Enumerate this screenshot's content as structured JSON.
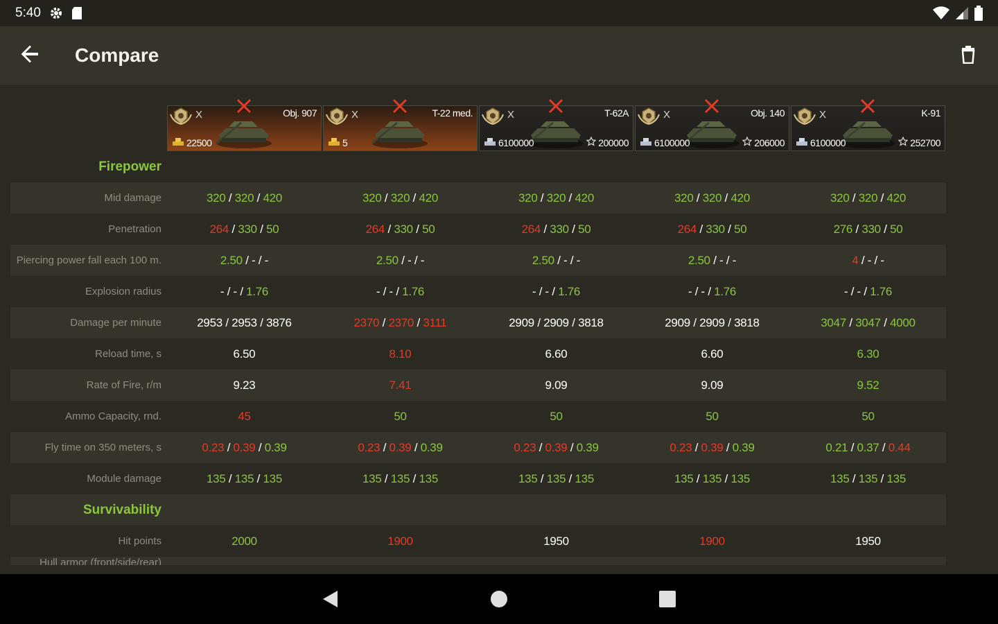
{
  "status": {
    "time": "5:40"
  },
  "app": {
    "title": "Compare"
  },
  "tanks": [
    {
      "tier": "X",
      "name": "Obj. 907",
      "price_left": "22500",
      "price_right": "",
      "premium": true
    },
    {
      "tier": "X",
      "name": "T-22 med.",
      "price_left": "5",
      "price_right": "",
      "premium": true
    },
    {
      "tier": "X",
      "name": "T-62A",
      "price_left": "6100000",
      "price_right": "200000",
      "premium": false
    },
    {
      "tier": "X",
      "name": "Obj. 140",
      "price_left": "6100000",
      "price_right": "206000",
      "premium": false
    },
    {
      "tier": "X",
      "name": "K-91",
      "price_left": "6100000",
      "price_right": "252700",
      "premium": false
    }
  ],
  "sections": {
    "firepower": "Firepower",
    "survivability": "Survivability"
  },
  "rows": {
    "mid_damage": {
      "label": "Mid damage",
      "values": [
        [
          [
            "320",
            "g"
          ],
          [
            "320",
            "g"
          ],
          [
            "420",
            "g"
          ]
        ],
        [
          [
            "320",
            "g"
          ],
          [
            "320",
            "g"
          ],
          [
            "420",
            "g"
          ]
        ],
        [
          [
            "320",
            "g"
          ],
          [
            "320",
            "g"
          ],
          [
            "420",
            "g"
          ]
        ],
        [
          [
            "320",
            "g"
          ],
          [
            "320",
            "g"
          ],
          [
            "420",
            "g"
          ]
        ],
        [
          [
            "320",
            "g"
          ],
          [
            "320",
            "g"
          ],
          [
            "420",
            "g"
          ]
        ]
      ]
    },
    "penetration": {
      "label": "Penetration",
      "values": [
        [
          [
            "264",
            "r"
          ],
          [
            "330",
            "g"
          ],
          [
            "50",
            "g"
          ]
        ],
        [
          [
            "264",
            "r"
          ],
          [
            "330",
            "g"
          ],
          [
            "50",
            "g"
          ]
        ],
        [
          [
            "264",
            "r"
          ],
          [
            "330",
            "g"
          ],
          [
            "50",
            "g"
          ]
        ],
        [
          [
            "264",
            "r"
          ],
          [
            "330",
            "g"
          ],
          [
            "50",
            "g"
          ]
        ],
        [
          [
            "276",
            "g"
          ],
          [
            "330",
            "g"
          ],
          [
            "50",
            "g"
          ]
        ]
      ]
    },
    "piercing_fall": {
      "label": "Piercing power fall each 100 m.",
      "values": [
        [
          [
            "2.50",
            "g"
          ],
          [
            "-",
            "w"
          ],
          [
            "-",
            "w"
          ]
        ],
        [
          [
            "2.50",
            "g"
          ],
          [
            "-",
            "w"
          ],
          [
            "-",
            "w"
          ]
        ],
        [
          [
            "2.50",
            "g"
          ],
          [
            "-",
            "w"
          ],
          [
            "-",
            "w"
          ]
        ],
        [
          [
            "2.50",
            "g"
          ],
          [
            "-",
            "w"
          ],
          [
            "-",
            "w"
          ]
        ],
        [
          [
            "4",
            "r"
          ],
          [
            "-",
            "w"
          ],
          [
            "-",
            "w"
          ]
        ]
      ]
    },
    "explosion_radius": {
      "label": "Explosion radius",
      "values": [
        [
          [
            "-",
            "w"
          ],
          [
            "-",
            "w"
          ],
          [
            "1.76",
            "g"
          ]
        ],
        [
          [
            "-",
            "w"
          ],
          [
            "-",
            "w"
          ],
          [
            "1.76",
            "g"
          ]
        ],
        [
          [
            "-",
            "w"
          ],
          [
            "-",
            "w"
          ],
          [
            "1.76",
            "g"
          ]
        ],
        [
          [
            "-",
            "w"
          ],
          [
            "-",
            "w"
          ],
          [
            "1.76",
            "g"
          ]
        ],
        [
          [
            "-",
            "w"
          ],
          [
            "-",
            "w"
          ],
          [
            "1.76",
            "g"
          ]
        ]
      ]
    },
    "dpm": {
      "label": "Damage per minute",
      "values": [
        [
          [
            "2953",
            "w"
          ],
          [
            "2953",
            "w"
          ],
          [
            "3876",
            "w"
          ]
        ],
        [
          [
            "2370",
            "r"
          ],
          [
            "2370",
            "r"
          ],
          [
            "3111",
            "r"
          ]
        ],
        [
          [
            "2909",
            "w"
          ],
          [
            "2909",
            "w"
          ],
          [
            "3818",
            "w"
          ]
        ],
        [
          [
            "2909",
            "w"
          ],
          [
            "2909",
            "w"
          ],
          [
            "3818",
            "w"
          ]
        ],
        [
          [
            "3047",
            "g"
          ],
          [
            "3047",
            "g"
          ],
          [
            "4000",
            "g"
          ]
        ]
      ]
    },
    "reload": {
      "label": "Reload time, s",
      "values": [
        [
          [
            "6.50",
            "w"
          ]
        ],
        [
          [
            "8.10",
            "r"
          ]
        ],
        [
          [
            "6.60",
            "w"
          ]
        ],
        [
          [
            "6.60",
            "w"
          ]
        ],
        [
          [
            "6.30",
            "g"
          ]
        ]
      ]
    },
    "rof": {
      "label": "Rate of Fire, r/m",
      "values": [
        [
          [
            "9.23",
            "w"
          ]
        ],
        [
          [
            "7.41",
            "r"
          ]
        ],
        [
          [
            "9.09",
            "w"
          ]
        ],
        [
          [
            "9.09",
            "w"
          ]
        ],
        [
          [
            "9.52",
            "g"
          ]
        ]
      ]
    },
    "ammo": {
      "label": "Ammo Capacity, rnd.",
      "values": [
        [
          [
            "45",
            "r"
          ]
        ],
        [
          [
            "50",
            "g"
          ]
        ],
        [
          [
            "50",
            "g"
          ]
        ],
        [
          [
            "50",
            "g"
          ]
        ],
        [
          [
            "50",
            "g"
          ]
        ]
      ]
    },
    "fly_time": {
      "label": "Fly time on 350 meters, s",
      "values": [
        [
          [
            "0.23",
            "r"
          ],
          [
            "0.39",
            "r"
          ],
          [
            "0.39",
            "g"
          ]
        ],
        [
          [
            "0.23",
            "r"
          ],
          [
            "0.39",
            "r"
          ],
          [
            "0.39",
            "g"
          ]
        ],
        [
          [
            "0.23",
            "r"
          ],
          [
            "0.39",
            "r"
          ],
          [
            "0.39",
            "g"
          ]
        ],
        [
          [
            "0.23",
            "r"
          ],
          [
            "0.39",
            "r"
          ],
          [
            "0.39",
            "g"
          ]
        ],
        [
          [
            "0.21",
            "g"
          ],
          [
            "0.37",
            "g"
          ],
          [
            "0.44",
            "r"
          ]
        ]
      ]
    },
    "module_damage": {
      "label": "Module damage",
      "values": [
        [
          [
            "135",
            "g"
          ],
          [
            "135",
            "g"
          ],
          [
            "135",
            "g"
          ]
        ],
        [
          [
            "135",
            "g"
          ],
          [
            "135",
            "g"
          ],
          [
            "135",
            "g"
          ]
        ],
        [
          [
            "135",
            "g"
          ],
          [
            "135",
            "g"
          ],
          [
            "135",
            "g"
          ]
        ],
        [
          [
            "135",
            "g"
          ],
          [
            "135",
            "g"
          ],
          [
            "135",
            "g"
          ]
        ],
        [
          [
            "135",
            "g"
          ],
          [
            "135",
            "g"
          ],
          [
            "135",
            "g"
          ]
        ]
      ]
    },
    "hit_points": {
      "label": "Hit points",
      "values": [
        [
          [
            "2000",
            "g"
          ]
        ],
        [
          [
            "1900",
            "r"
          ]
        ],
        [
          [
            "1950",
            "w"
          ]
        ],
        [
          [
            "1900",
            "r"
          ]
        ],
        [
          [
            "1950",
            "w"
          ]
        ]
      ]
    },
    "hull_armor": {
      "label": "Hull armor (front/side/rear)"
    }
  },
  "colors": {
    "green": "#8cc63f",
    "red": "#e53a25",
    "white": "#ffffff"
  },
  "icons": [
    "back-arrow-icon",
    "trash-icon",
    "settings-icon",
    "sd-card-icon",
    "wifi-icon",
    "signal-icon",
    "battery-icon",
    "close-x-icon",
    "tier-emblem-icon",
    "gold-icon",
    "credits-icon",
    "xp-star-icon",
    "tank-icon"
  ]
}
